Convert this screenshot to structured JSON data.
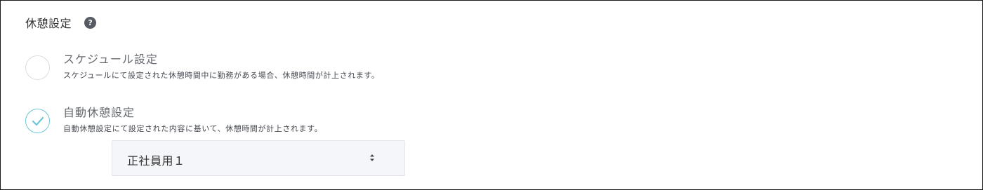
{
  "section": {
    "title": "休憩設定",
    "help_icon": "question-circle-icon",
    "help_glyph": "?"
  },
  "options": [
    {
      "label": "スケジュール設定",
      "description": "スケジュールにて設定された休憩時間中に勤務がある場合、休憩時間が計上されます。",
      "checked": false
    },
    {
      "label": "自動休憩設定",
      "description": "自動休憩設定にて設定された内容に基いて、休憩時間が計上されます。",
      "checked": true
    }
  ],
  "select": {
    "value": "正社員用１",
    "icon": "sort-arrows-icon"
  },
  "colors": {
    "accent": "#6cc7d7",
    "border": "#1a1a1a",
    "select_bg": "#f5f6fa",
    "help_icon_bg": "#555a63"
  }
}
